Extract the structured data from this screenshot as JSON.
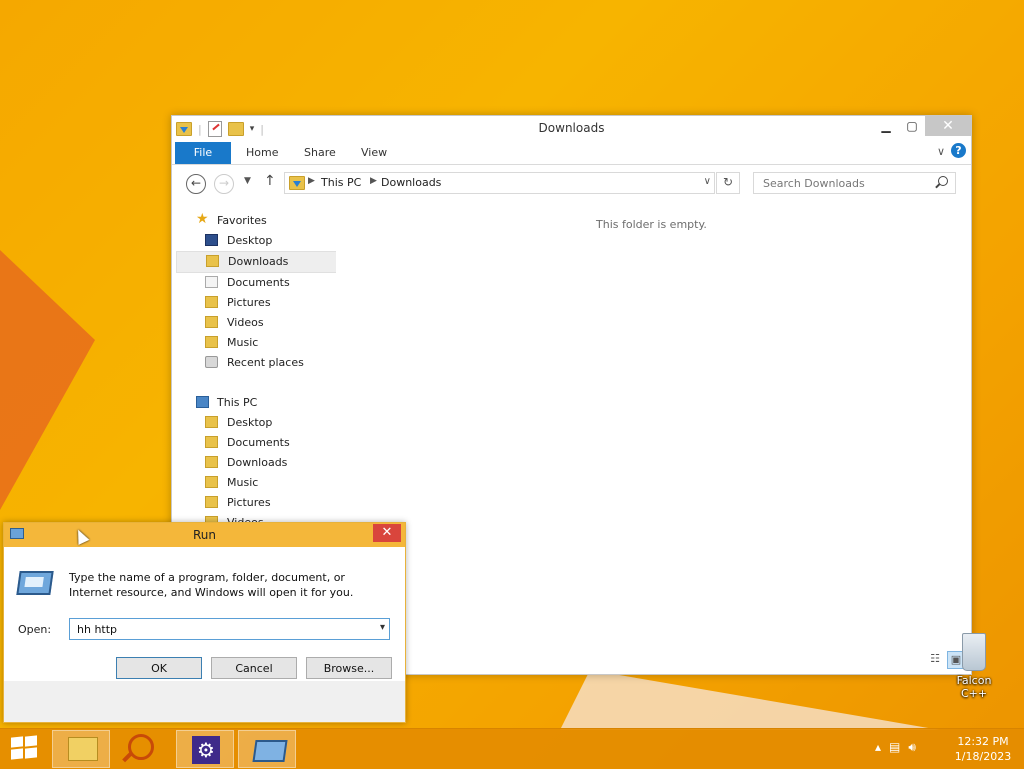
{
  "explorer": {
    "title": "Downloads",
    "ribbon": {
      "file": "File",
      "home": "Home",
      "share": "Share",
      "view": "View"
    },
    "address": {
      "root": "This PC",
      "current": "Downloads"
    },
    "search_placeholder": "Search Downloads",
    "empty_message": "This folder is empty.",
    "favorites": {
      "label": "Favorites",
      "items": [
        "Desktop",
        "Downloads",
        "Documents",
        "Pictures",
        "Videos",
        "Music",
        "Recent places"
      ]
    },
    "this_pc": {
      "label": "This PC",
      "items": [
        "Desktop",
        "Documents",
        "Downloads",
        "Music",
        "Pictures",
        "Videos"
      ]
    }
  },
  "run_dialog": {
    "title": "Run",
    "description": "Type the name of a program, folder, document, or Internet resource, and Windows will open it for you.",
    "open_label": "Open:",
    "open_value": "hh http",
    "ok_label": "OK",
    "cancel_label": "Cancel",
    "browse_label": "Browse..."
  },
  "desktop": {
    "recycle_label": "Falcon C++"
  },
  "taskbar": {
    "time": "12:32 PM",
    "date": "1/18/2023"
  },
  "colors": {
    "accent": "#1979ca",
    "desktop": "#f5a800",
    "run_title": "#f4b73a"
  }
}
